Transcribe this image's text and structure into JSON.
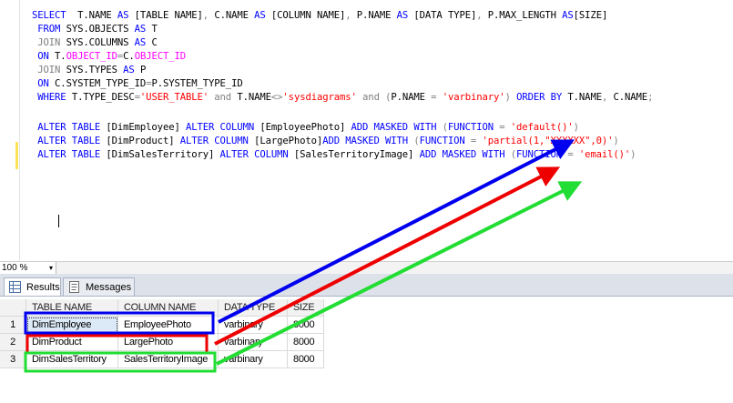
{
  "editor": {
    "lines": [
      [
        {
          "c": "kw",
          "t": "SELECT  "
        },
        {
          "c": "tx",
          "t": "T.NAME "
        },
        {
          "c": "kw",
          "t": "AS "
        },
        {
          "c": "tx",
          "t": "[TABLE NAME]"
        },
        {
          "c": "gr",
          "t": ", "
        },
        {
          "c": "tx",
          "t": "C.NAME "
        },
        {
          "c": "kw",
          "t": "AS "
        },
        {
          "c": "tx",
          "t": "[COLUMN NAME]"
        },
        {
          "c": "gr",
          "t": ", "
        },
        {
          "c": "tx",
          "t": "P.NAME "
        },
        {
          "c": "kw",
          "t": "AS "
        },
        {
          "c": "tx",
          "t": "[DATA TYPE]"
        },
        {
          "c": "gr",
          "t": ", "
        },
        {
          "c": "tx",
          "t": "P.MAX_LENGTH "
        },
        {
          "c": "kw",
          "t": "AS"
        },
        {
          "c": "tx",
          "t": "[SIZE]"
        }
      ],
      [
        {
          "c": "kw",
          "t": " FROM "
        },
        {
          "c": "tx",
          "t": "SYS.OBJECTS "
        },
        {
          "c": "kw",
          "t": "AS "
        },
        {
          "c": "tx",
          "t": "T"
        }
      ],
      [
        {
          "c": "gr",
          "t": " JOIN "
        },
        {
          "c": "tx",
          "t": "SYS.COLUMNS "
        },
        {
          "c": "kw",
          "t": "AS "
        },
        {
          "c": "tx",
          "t": "C"
        }
      ],
      [
        {
          "c": "kw",
          "t": " ON "
        },
        {
          "c": "tx",
          "t": "T."
        },
        {
          "c": "pk",
          "t": "OBJECT_ID"
        },
        {
          "c": "gr",
          "t": "="
        },
        {
          "c": "tx",
          "t": "C."
        },
        {
          "c": "pk",
          "t": "OBJECT_ID"
        }
      ],
      [
        {
          "c": "gr",
          "t": " JOIN "
        },
        {
          "c": "tx",
          "t": "SYS.TYPES "
        },
        {
          "c": "kw",
          "t": "AS "
        },
        {
          "c": "tx",
          "t": "P"
        }
      ],
      [
        {
          "c": "kw",
          "t": " ON "
        },
        {
          "c": "tx",
          "t": "C.SYSTEM_TYPE_ID"
        },
        {
          "c": "gr",
          "t": "="
        },
        {
          "c": "tx",
          "t": "P.SYSTEM_TYPE_ID"
        }
      ],
      [
        {
          "c": "kw",
          "t": " WHERE "
        },
        {
          "c": "tx",
          "t": "T.TYPE_DESC"
        },
        {
          "c": "gr",
          "t": "="
        },
        {
          "c": "st",
          "t": "'USER_TABLE' "
        },
        {
          "c": "gr",
          "t": "and "
        },
        {
          "c": "tx",
          "t": "T.NAME"
        },
        {
          "c": "gr",
          "t": "<>"
        },
        {
          "c": "st",
          "t": "'sysdiagrams' "
        },
        {
          "c": "gr",
          "t": "and "
        },
        {
          "c": "gr",
          "t": "("
        },
        {
          "c": "tx",
          "t": "P.NAME "
        },
        {
          "c": "gr",
          "t": "= "
        },
        {
          "c": "st",
          "t": "'varbinary'"
        },
        {
          "c": "gr",
          "t": ") "
        },
        {
          "c": "kw",
          "t": "ORDER BY "
        },
        {
          "c": "tx",
          "t": "T.NAME"
        },
        {
          "c": "gr",
          "t": ", "
        },
        {
          "c": "tx",
          "t": "C.NAME"
        },
        {
          "c": "gr",
          "t": ";"
        }
      ],
      [],
      [
        {
          "c": "kw",
          "t": " ALTER TABLE "
        },
        {
          "c": "tx",
          "t": "[DimEmployee] "
        },
        {
          "c": "kw",
          "t": "ALTER COLUMN "
        },
        {
          "c": "tx",
          "t": "[EmployeePhoto] "
        },
        {
          "c": "kw",
          "t": "ADD MASKED WITH "
        },
        {
          "c": "gr",
          "t": "("
        },
        {
          "c": "kw",
          "t": "FUNCTION "
        },
        {
          "c": "gr",
          "t": "= "
        },
        {
          "c": "st",
          "t": "'default()'"
        },
        {
          "c": "gr",
          "t": ")"
        }
      ],
      [
        {
          "c": "kw",
          "t": " ALTER TABLE "
        },
        {
          "c": "tx",
          "t": "[DimProduct] "
        },
        {
          "c": "kw",
          "t": "ALTER COLUMN "
        },
        {
          "c": "tx",
          "t": "[LargePhoto]"
        },
        {
          "c": "kw",
          "t": "ADD MASKED WITH "
        },
        {
          "c": "gr",
          "t": "("
        },
        {
          "c": "kw",
          "t": "FUNCTION "
        },
        {
          "c": "gr",
          "t": "= "
        },
        {
          "c": "st",
          "t": "'partial(1,\"XXXXXX\",0)'"
        },
        {
          "c": "gr",
          "t": ")"
        }
      ],
      [
        {
          "c": "kw",
          "t": " ALTER TABLE "
        },
        {
          "c": "tx",
          "t": "[DimSalesTerritory] "
        },
        {
          "c": "kw",
          "t": "ALTER COLUMN "
        },
        {
          "c": "tx",
          "t": "[SalesTerritoryImage] "
        },
        {
          "c": "kw",
          "t": "ADD MASKED WITH "
        },
        {
          "c": "gr",
          "t": "("
        },
        {
          "c": "kw",
          "t": "FUNCTION "
        },
        {
          "c": "gr",
          "t": "= "
        },
        {
          "c": "st",
          "t": "'email()'"
        },
        {
          "c": "gr",
          "t": ")"
        }
      ]
    ]
  },
  "zoom": {
    "value": "100 %",
    "caret": "▾"
  },
  "tabs": [
    {
      "label": "Results",
      "icon": "grid-icon",
      "active": true
    },
    {
      "label": "Messages",
      "icon": "messages-icon",
      "active": false
    }
  ],
  "grid": {
    "columns": [
      "TABLE NAME",
      "COLUMN NAME",
      "DATA TYPE",
      "SIZE"
    ],
    "rows": [
      {
        "num": "1",
        "cells": [
          "DimEmployee",
          "EmployeePhoto",
          "varbinary",
          "8000"
        ]
      },
      {
        "num": "2",
        "cells": [
          "DimProduct",
          "LargePhoto",
          "varbinary",
          "8000"
        ]
      },
      {
        "num": "3",
        "cells": [
          "DimSalesTerritory",
          "SalesTerritoryImage",
          "varbinary",
          "8000"
        ]
      }
    ]
  },
  "annotation_colors": {
    "blue": "#0000ee",
    "red": "#ee0000",
    "green": "#22dd33"
  }
}
